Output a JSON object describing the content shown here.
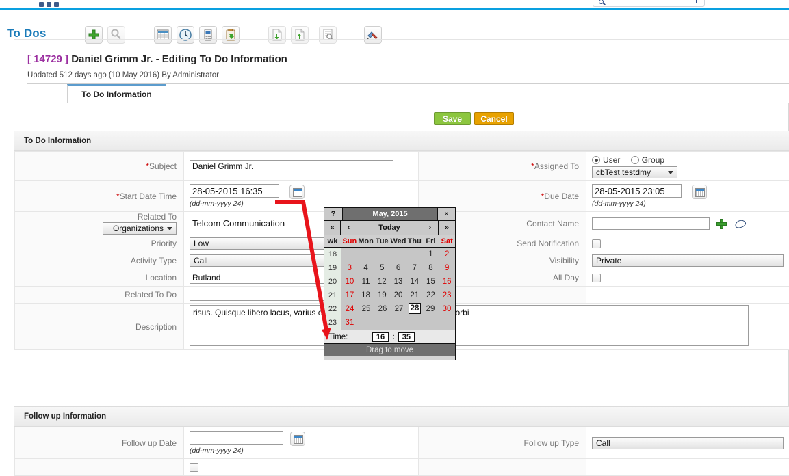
{
  "browser": {
    "apps_dots": "apps-grid",
    "search_placeholder": ""
  },
  "module": {
    "title": "To Dos",
    "toolbar": [
      {
        "name": "add-icon",
        "tip": "Add"
      },
      {
        "name": "search-icon",
        "tip": "Search"
      },
      {
        "name": "calendar-view-icon",
        "tip": "Calendar View"
      },
      {
        "name": "clock-icon",
        "tip": "Activity"
      },
      {
        "name": "device-icon",
        "tip": "Mobile"
      },
      {
        "name": "clipboard-icon",
        "tip": "To Do List"
      },
      {
        "name": "import-icon",
        "tip": "Import"
      },
      {
        "name": "export-icon",
        "tip": "Export"
      },
      {
        "name": "print-preview-icon",
        "tip": "Print"
      },
      {
        "name": "tools-icon",
        "tip": "Settings"
      }
    ]
  },
  "record": {
    "id": "[ 14729 ]",
    "title": "Daniel Grimm Jr. - Editing To Do Information",
    "subtitle": "Updated 512 days ago (10 May 2016) By Administrator"
  },
  "tabs": [
    {
      "label": "To Do Information",
      "active": true
    }
  ],
  "actions": {
    "save_label": "Save",
    "cancel_label": "Cancel",
    "save_color": "#8cc63f",
    "cancel_color": "#e8a200"
  },
  "sections": [
    {
      "title": "To Do Information"
    },
    {
      "title": "Follow up Information"
    }
  ],
  "form": {
    "left": [
      {
        "label": "Subject",
        "required": true,
        "type": "text",
        "value": "Daniel Grimm Jr."
      },
      {
        "label": "Start Date Time",
        "required": true,
        "type": "datetime",
        "value": "28-05-2015 16:35",
        "hint": "(dd-mm-yyyy 24)"
      },
      {
        "label": "Related To",
        "required": false,
        "type": "related",
        "select_value": "Organizations",
        "value": "Telcom Communication"
      },
      {
        "label": "Priority",
        "required": false,
        "type": "select",
        "value": "Low"
      },
      {
        "label": "Activity Type",
        "required": false,
        "type": "select",
        "value": "Call"
      },
      {
        "label": "Location",
        "required": false,
        "type": "text",
        "value": "Rutland"
      },
      {
        "label": "Related To Do",
        "required": false,
        "type": "text",
        "value": ""
      }
    ],
    "right": [
      {
        "label": "Assigned To",
        "required": true,
        "type": "assigned",
        "radio_user": "User",
        "radio_group": "Group",
        "selected_radio": "User",
        "value": "cbTest testdmy"
      },
      {
        "label": "Due Date",
        "required": true,
        "type": "datetime",
        "value": "28-05-2015 23:05",
        "hint": "(dd-mm-yyyy 24)"
      },
      {
        "label": "Contact Name",
        "required": false,
        "type": "lookup",
        "value": ""
      },
      {
        "label": "Send Notification",
        "required": false,
        "type": "checkbox",
        "checked": false
      },
      {
        "label": "Visibility",
        "required": false,
        "type": "select",
        "value": "Private"
      },
      {
        "label": "All Day",
        "required": false,
        "type": "checkbox",
        "checked": false
      }
    ],
    "description": {
      "label": "Description",
      "value": "risus. Quisque libero lacus, varius et, euismod et, commodo at, libero. Morbi"
    },
    "followup": [
      {
        "label": "Follow up Date",
        "type": "datetime",
        "value": "",
        "hint": "(dd-mm-yyyy 24)"
      },
      {
        "label": "Follow up Type",
        "type": "select",
        "value": "Call"
      }
    ]
  },
  "calendar": {
    "help_label": "?",
    "close_label": "×",
    "month_title": "May, 2015",
    "nav": {
      "first": "«",
      "prev": "‹",
      "today": "Today",
      "next": "›",
      "last": "»"
    },
    "dow_header": [
      "wk",
      "Sun",
      "Mon",
      "Tue",
      "Wed",
      "Thu",
      "Fri",
      "Sat"
    ],
    "weekend_cols": [
      1,
      7
    ],
    "weeks": [
      {
        "wk": "18",
        "days": [
          "",
          "",
          "",
          "",
          "",
          "1",
          "2"
        ]
      },
      {
        "wk": "19",
        "days": [
          "3",
          "4",
          "5",
          "6",
          "7",
          "8",
          "9"
        ]
      },
      {
        "wk": "20",
        "days": [
          "10",
          "11",
          "12",
          "13",
          "14",
          "15",
          "16"
        ]
      },
      {
        "wk": "21",
        "days": [
          "17",
          "18",
          "19",
          "20",
          "21",
          "22",
          "23"
        ]
      },
      {
        "wk": "22",
        "days": [
          "24",
          "25",
          "26",
          "27",
          "28",
          "29",
          "30"
        ]
      },
      {
        "wk": "23",
        "days": [
          "31",
          "",
          "",
          "",
          "",
          "",
          ""
        ]
      }
    ],
    "selected_day": "28",
    "time_label": "Time:",
    "hour": "16",
    "minute": "35",
    "time_sep": ":",
    "drag_label": "Drag to move"
  },
  "annotation": {
    "color": "#e8141b",
    "name": "red-arrow-annotation"
  }
}
